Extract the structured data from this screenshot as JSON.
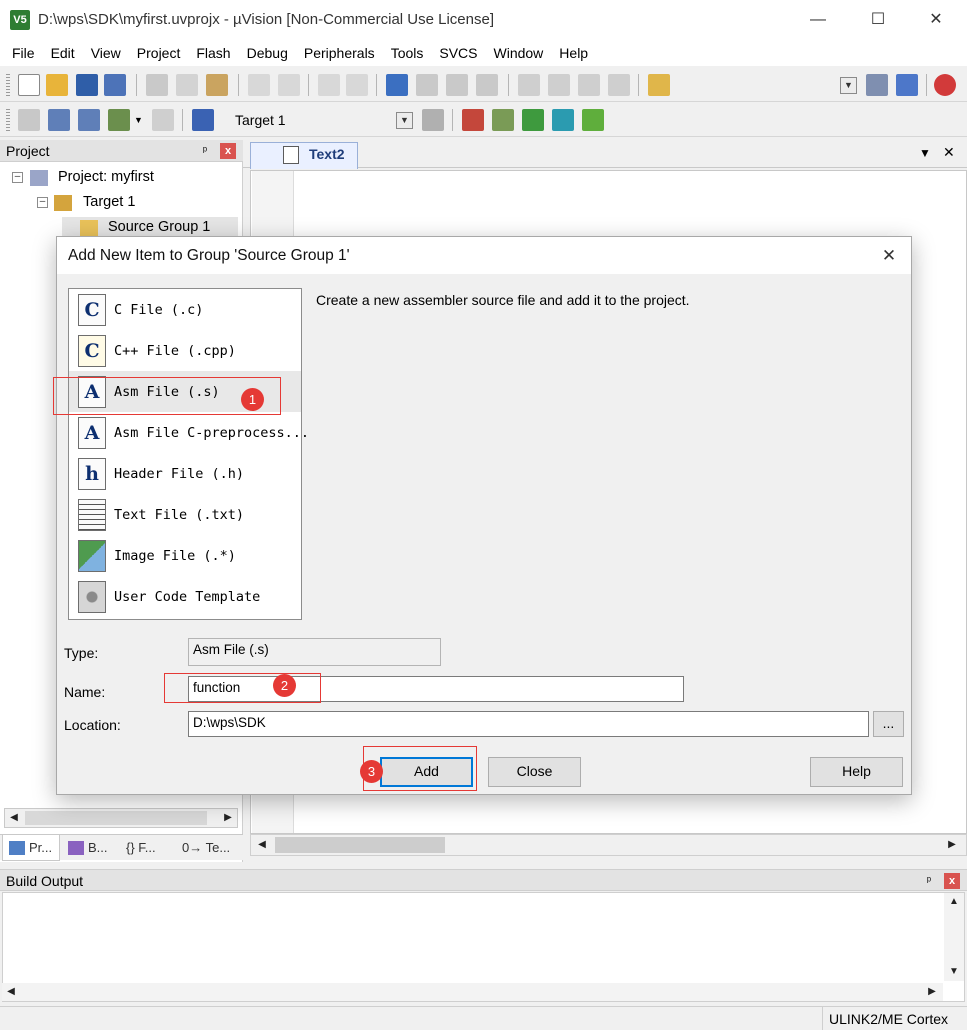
{
  "window": {
    "title": "D:\\wps\\SDK\\myfirst.uvprojx - µVision  [Non-Commercial Use License]",
    "app_icon": "V5",
    "controls": {
      "minimize": "—",
      "maximize": "☐",
      "close": "✕"
    }
  },
  "menu": [
    "File",
    "Edit",
    "View",
    "Project",
    "Flash",
    "Debug",
    "Peripherals",
    "Tools",
    "SVCS",
    "Window",
    "Help"
  ],
  "toolbar2": {
    "target_select": "Target 1"
  },
  "project_panel": {
    "title": "Project",
    "pin": "ᵖ",
    "close": "x",
    "tree": {
      "project": "Project: myfirst",
      "target": "Target 1",
      "group": "Source Group 1"
    },
    "bottom_tabs": [
      "Pr...",
      "B...",
      "{} F...",
      "0→ Te..."
    ]
  },
  "editor": {
    "tab": "Text2",
    "dropdown": "▼",
    "close": "✕"
  },
  "build_output": {
    "title": "Build Output"
  },
  "statusbar": {
    "debugger": "ULINK2/ME Cortex"
  },
  "dialog": {
    "title": "Add New Item to Group 'Source Group 1'",
    "close": "✕",
    "description": "Create a new assembler source file and add it to the project.",
    "items": [
      {
        "label": "C File (.c)",
        "icon_letter": "C",
        "icon": "c-file-icon"
      },
      {
        "label": "C++ File (.cpp)",
        "icon_letter": "C",
        "icon": "cpp-file-icon"
      },
      {
        "label": "Asm File (.s)",
        "icon_letter": "A",
        "icon": "asm-file-icon"
      },
      {
        "label": "Asm File C-preprocess...",
        "icon_letter": "A",
        "icon": "asm-preprocess-file-icon"
      },
      {
        "label": "Header File (.h)",
        "icon_letter": "h",
        "icon": "header-file-icon"
      },
      {
        "label": "Text File (.txt)",
        "icon_letter": "",
        "icon": "text-file-icon"
      },
      {
        "label": "Image File (.*)",
        "icon_letter": "",
        "icon": "image-file-icon"
      },
      {
        "label": "User Code Template",
        "icon_letter": "",
        "icon": "user-template-icon"
      }
    ],
    "type_label": "Type:",
    "type_value": "Asm File (.s)",
    "name_label": "Name:",
    "name_value": "function",
    "location_label": "Location:",
    "location_value": "D:\\wps\\SDK",
    "browse_label": "...",
    "add_label": "Add",
    "close_label": "Close",
    "help_label": "Help"
  },
  "annotations": [
    "1",
    "2",
    "3"
  ],
  "colors": {
    "annotation_red": "#e53935",
    "focus_blue": "#0078d7",
    "icon_navy": "#0d2f70"
  }
}
